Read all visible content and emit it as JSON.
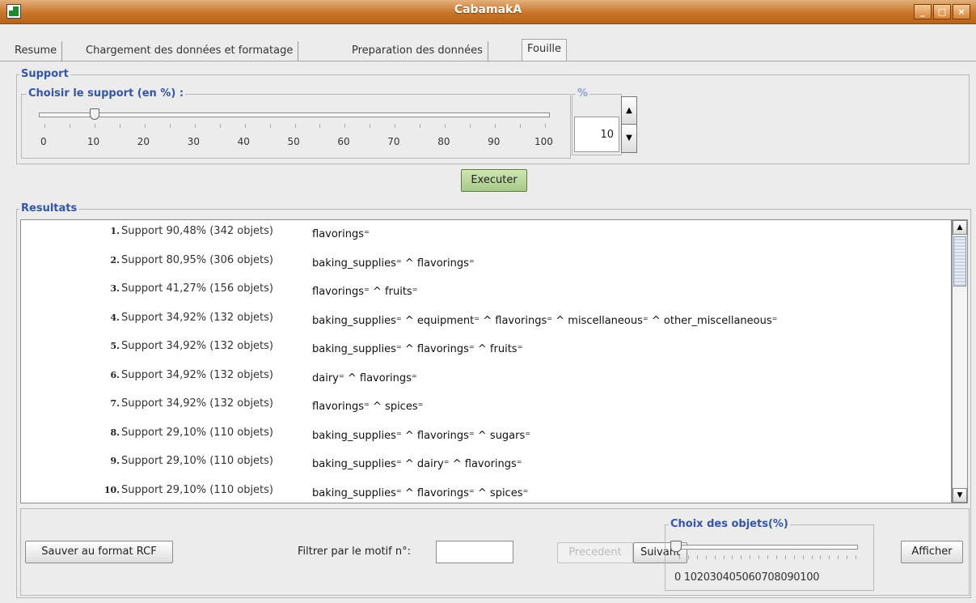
{
  "window": {
    "title": "CabamakA",
    "controls": [
      "_",
      "□",
      "×"
    ]
  },
  "tabs": [
    "Resume",
    "Chargement des données et formatage",
    "Preparation des données",
    "Fouille"
  ],
  "support": {
    "group_label": "Support",
    "slider_label": "Choisir le support (en %) :",
    "slider_value": 10,
    "tick_labels": [
      "0",
      "10",
      "20",
      "30",
      "40",
      "50",
      "60",
      "70",
      "80",
      "90",
      "100"
    ],
    "spinner_label": "%",
    "spinner_value": "10"
  },
  "execute_button": "Executer",
  "results": {
    "group_label": "Resultats",
    "rows": [
      {
        "num": "1.",
        "support": "Support 90,48% (342 objets)",
        "motif": "flavorings⁼"
      },
      {
        "num": "2.",
        "support": "Support 80,95% (306 objets)",
        "motif": "baking_supplies⁼ ^ flavorings⁼"
      },
      {
        "num": "3.",
        "support": "Support 41,27% (156 objets)",
        "motif": "flavorings⁼ ^ fruits⁼"
      },
      {
        "num": "4.",
        "support": "Support 34,92% (132 objets)",
        "motif": "baking_supplies⁼ ^ equipment⁼ ^ flavorings⁼ ^ miscellaneous⁼ ^ other_miscellaneous⁼"
      },
      {
        "num": "5.",
        "support": "Support 34,92% (132 objets)",
        "motif": "baking_supplies⁼ ^ flavorings⁼ ^ fruits⁼"
      },
      {
        "num": "6.",
        "support": "Support 34,92% (132 objets)",
        "motif": "dairy⁼ ^ flavorings⁼"
      },
      {
        "num": "7.",
        "support": "Support 34,92% (132 objets)",
        "motif": "flavorings⁼ ^ spices⁼"
      },
      {
        "num": "8.",
        "support": "Support 29,10% (110 objets)",
        "motif": "baking_supplies⁼ ^ flavorings⁼ ^ sugars⁼"
      },
      {
        "num": "9.",
        "support": "Support 29,10% (110 objets)",
        "motif": "baking_supplies⁼ ^ dairy⁼ ^ flavorings⁼"
      },
      {
        "num": "10.",
        "support": "Support 29,10% (110 objets)",
        "motif": "baking_supplies⁼ ^ flavorings⁼ ^ spices⁼"
      }
    ]
  },
  "bottom": {
    "save_button": "Sauver au format RCF",
    "filter_label": "Filtrer par le motif n°:",
    "filter_value": "",
    "prev_button": "Precedent",
    "next_button": "Suivant",
    "choice_label": "Choix des objets(%)",
    "choice_slider_value": 0,
    "choice_tick_text": "0 102030405060708090100",
    "show_button": "Afficher"
  }
}
